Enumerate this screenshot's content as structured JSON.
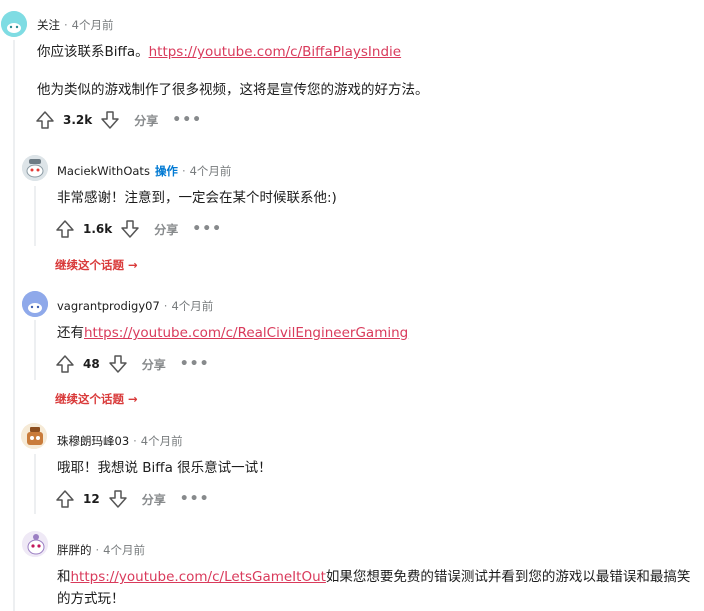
{
  "comments": [
    {
      "author": "关注",
      "time": "4个月前",
      "body_prefix": "你应该联系Biffa。",
      "link": "https://youtube.com/c/BiffaPlaysIndie",
      "body_line2": "他为类似的游戏制作了很多视频，这将是宣传您的游戏的好方法。",
      "score": "3.2k",
      "share": "分享",
      "more": "•••"
    },
    {
      "author": "MaciekWithOats",
      "op_badge": "操作",
      "time": "4个月前",
      "body": "非常感谢！注意到，一定会在某个时候联系他:)",
      "score": "1.6k",
      "share": "分享",
      "more": "•••",
      "continue": "继续这个话题 →"
    },
    {
      "author": "vagrantprodigy07",
      "time": "4个月前",
      "body_prefix": "还有",
      "link": "https://youtube.com/c/RealCivilEngineerGaming",
      "score": "48",
      "share": "分享",
      "more": "•••",
      "continue": "继续这个话题 →"
    },
    {
      "author": "珠穆朗玛峰03",
      "time": "4个月前",
      "body": "哦耶！我想说 Biffa 很乐意试一试！",
      "score": "12",
      "share": "分享",
      "more": "•••"
    },
    {
      "author": "胖胖的",
      "time": "4个月前",
      "body_prefix": "和",
      "link": "https://youtube.com/c/LetsGameItOut",
      "body_suffix": "如果您想要免费的错误测试并看到您的游戏以最错误和最搞笑的方式玩！"
    }
  ],
  "separator": "·",
  "colors": {
    "link": "#d93a5b",
    "op": "#0079d3",
    "continue": "#d93a3a"
  },
  "icons": [
    "upvote-icon",
    "downvote-icon",
    "snoo-avatar"
  ]
}
